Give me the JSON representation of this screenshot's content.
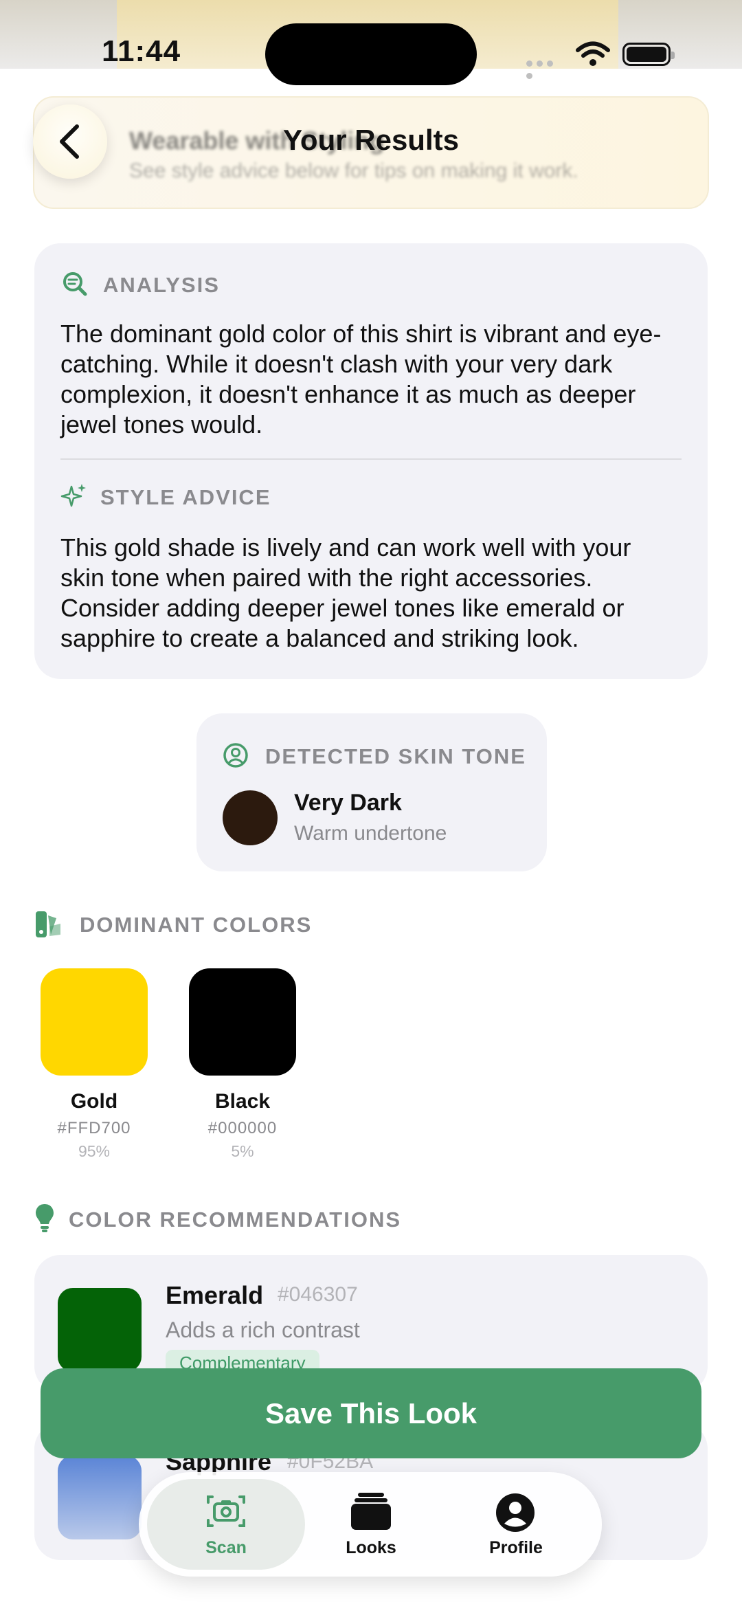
{
  "status_bar": {
    "time": "11:44"
  },
  "header": {
    "title": "Your Results",
    "verdict_title": "Wearable with Styling",
    "verdict_subtitle": "See style advice below for tips on making it work."
  },
  "analysis": {
    "label": "ANALYSIS",
    "text": "The dominant gold color of this shirt is vibrant and eye-catching. While it doesn't clash with your very dark complexion, it doesn't enhance it as much as deeper jewel tones would."
  },
  "style_advice": {
    "label": "STYLE ADVICE",
    "text": "This gold shade is lively and can work well with your skin tone when paired with the right accessories. Consider adding deeper jewel tones like emerald or sapphire to create a balanced and striking look."
  },
  "skin_tone": {
    "label": "DETECTED SKIN TONE",
    "name": "Very Dark",
    "undertone": "Warm undertone",
    "color": "#2c1a0e"
  },
  "dominant_colors": {
    "label": "DOMINANT COLORS",
    "items": [
      {
        "name": "Gold",
        "hex": "#FFD700",
        "percent": "95%"
      },
      {
        "name": "Black",
        "hex": "#000000",
        "percent": "5%"
      }
    ]
  },
  "recommendations": {
    "label": "COLOR RECOMMENDATIONS",
    "items": [
      {
        "name": "Emerald",
        "hex": "#046307",
        "reason": "Adds a rich contrast",
        "tag": "Complementary"
      },
      {
        "name": "Sapphire",
        "hex": "#0F52BA"
      }
    ]
  },
  "save_button": "Save This Look",
  "tabs": [
    {
      "label": "Scan",
      "icon": "camera-icon",
      "active": true
    },
    {
      "label": "Looks",
      "icon": "stack-icon",
      "active": false
    },
    {
      "label": "Profile",
      "icon": "person-icon",
      "active": false
    }
  ],
  "colors": {
    "accent": "#479b6a",
    "card": "#f2f2f7",
    "muted": "#8a8a8e"
  }
}
